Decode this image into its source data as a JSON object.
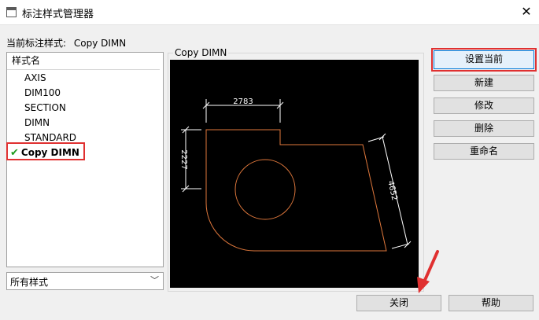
{
  "window": {
    "title": "标注样式管理器",
    "close_glyph": "✕"
  },
  "current": {
    "label": "当前标注样式:",
    "value": "Copy DIMN"
  },
  "style_list": {
    "header": "样式名",
    "items": [
      "AXIS",
      "DIM100",
      "SECTION",
      "DIMN",
      "STANDARD"
    ],
    "selected": "Copy DIMN",
    "selected_icon": "checkmark-icon"
  },
  "filter": {
    "value": "所有样式"
  },
  "preview": {
    "label": "Copy DIMN",
    "dim_top": "2783",
    "dim_left": "2227",
    "dim_right": "4652",
    "line_color": "#e0783c",
    "dim_color": "#ffffff"
  },
  "buttons": {
    "set_current": "设置当前",
    "new": "新建",
    "modify": "修改",
    "delete": "删除",
    "rename": "重命名",
    "close": "关闭",
    "help": "帮助"
  },
  "annotation_color": "#e03030"
}
